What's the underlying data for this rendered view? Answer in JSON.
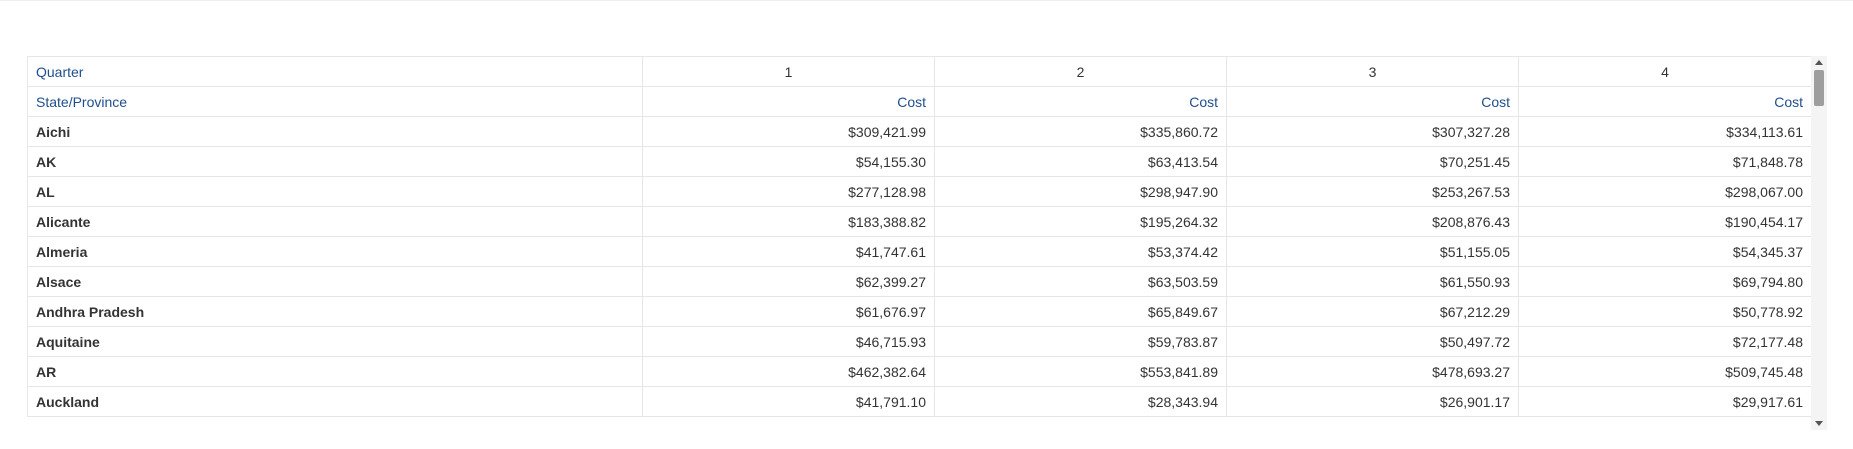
{
  "header": {
    "row_dimension_label": "Quarter",
    "row_label_title": "State/Province",
    "quarters": [
      "1",
      "2",
      "3",
      "4"
    ],
    "measure": "Cost"
  },
  "rows": [
    {
      "label": "Aichi",
      "values": [
        "$309,421.99",
        "$335,860.72",
        "$307,327.28",
        "$334,113.61"
      ]
    },
    {
      "label": "AK",
      "values": [
        "$54,155.30",
        "$63,413.54",
        "$70,251.45",
        "$71,848.78"
      ]
    },
    {
      "label": "AL",
      "values": [
        "$277,128.98",
        "$298,947.90",
        "$253,267.53",
        "$298,067.00"
      ]
    },
    {
      "label": "Alicante",
      "values": [
        "$183,388.82",
        "$195,264.32",
        "$208,876.43",
        "$190,454.17"
      ]
    },
    {
      "label": "Almeria",
      "values": [
        "$41,747.61",
        "$53,374.42",
        "$51,155.05",
        "$54,345.37"
      ]
    },
    {
      "label": "Alsace",
      "values": [
        "$62,399.27",
        "$63,503.59",
        "$61,550.93",
        "$69,794.80"
      ]
    },
    {
      "label": "Andhra Pradesh",
      "values": [
        "$61,676.97",
        "$65,849.67",
        "$67,212.29",
        "$50,778.92"
      ]
    },
    {
      "label": "Aquitaine",
      "values": [
        "$46,715.93",
        "$59,783.87",
        "$50,497.72",
        "$72,177.48"
      ]
    },
    {
      "label": "AR",
      "values": [
        "$462,382.64",
        "$553,841.89",
        "$478,693.27",
        "$509,745.48"
      ]
    },
    {
      "label": "Auckland",
      "values": [
        "$41,791.10",
        "$28,343.94",
        "$26,901.17",
        "$29,917.61"
      ]
    }
  ],
  "icons": {
    "scroll_up": "caret-up-icon",
    "scroll_down": "caret-down-icon"
  },
  "colors": {
    "header_text": "#1f4e8c",
    "grid_border": "#e6e6e6",
    "scroll_thumb": "#9e9e9e"
  }
}
